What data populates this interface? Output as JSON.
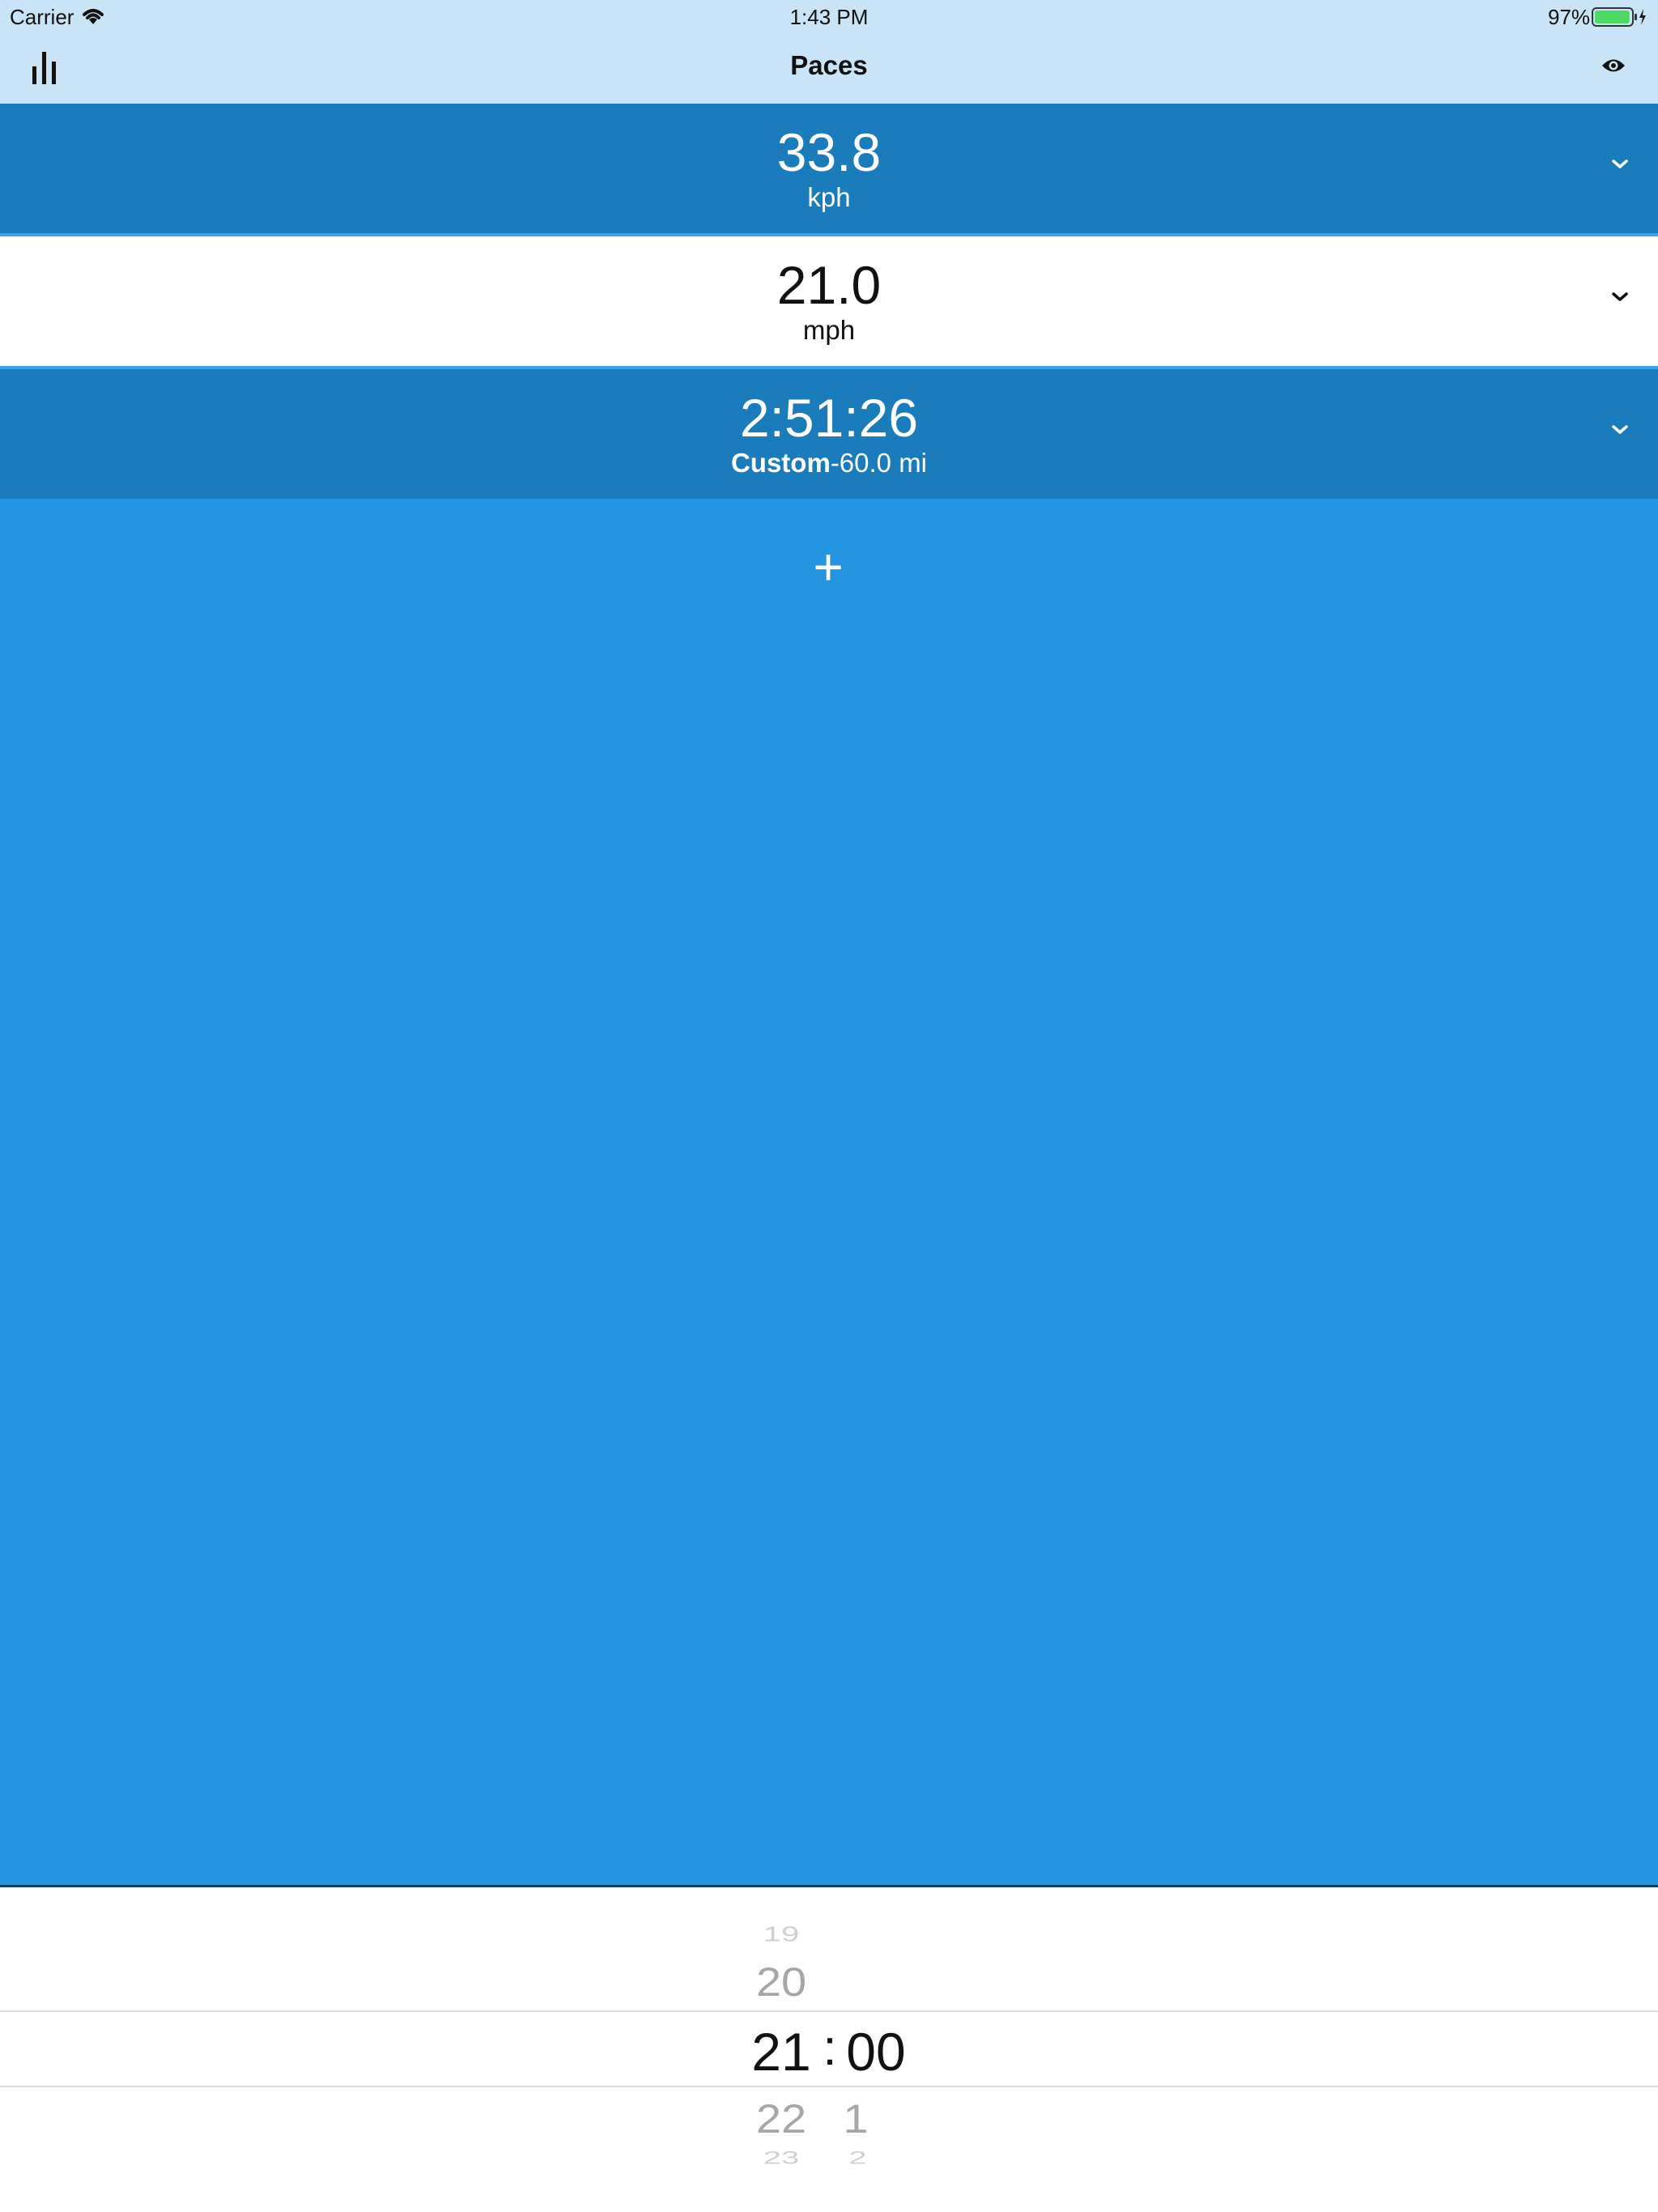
{
  "status_bar": {
    "carrier": "Carrier",
    "time": "1:43 PM",
    "battery": "97%",
    "battery_level": 0.97
  },
  "nav": {
    "title": "Paces",
    "left_icon": "bar-chart-icon",
    "right_icon": "eye-icon"
  },
  "rows": [
    {
      "value": "33.8",
      "unit": "kph"
    },
    {
      "value": "21.0",
      "unit": "mph"
    },
    {
      "value": "2:51:26",
      "unit_bold": "Custom",
      "unit_rest": "-60.0 mi"
    }
  ],
  "add_button": {
    "label": "+"
  },
  "picker": {
    "hours": [
      "19",
      "20",
      "21",
      "22",
      "23"
    ],
    "selected_hour": "21",
    "separator": ":",
    "minutes_selected": "00",
    "minutes_after": [
      "1",
      "2"
    ]
  },
  "colors": {
    "nav_bg": "#c8e4f6",
    "row_dark": "#1b7cbc",
    "content_blue": "#2595e1",
    "battery_green": "#4cd964"
  }
}
